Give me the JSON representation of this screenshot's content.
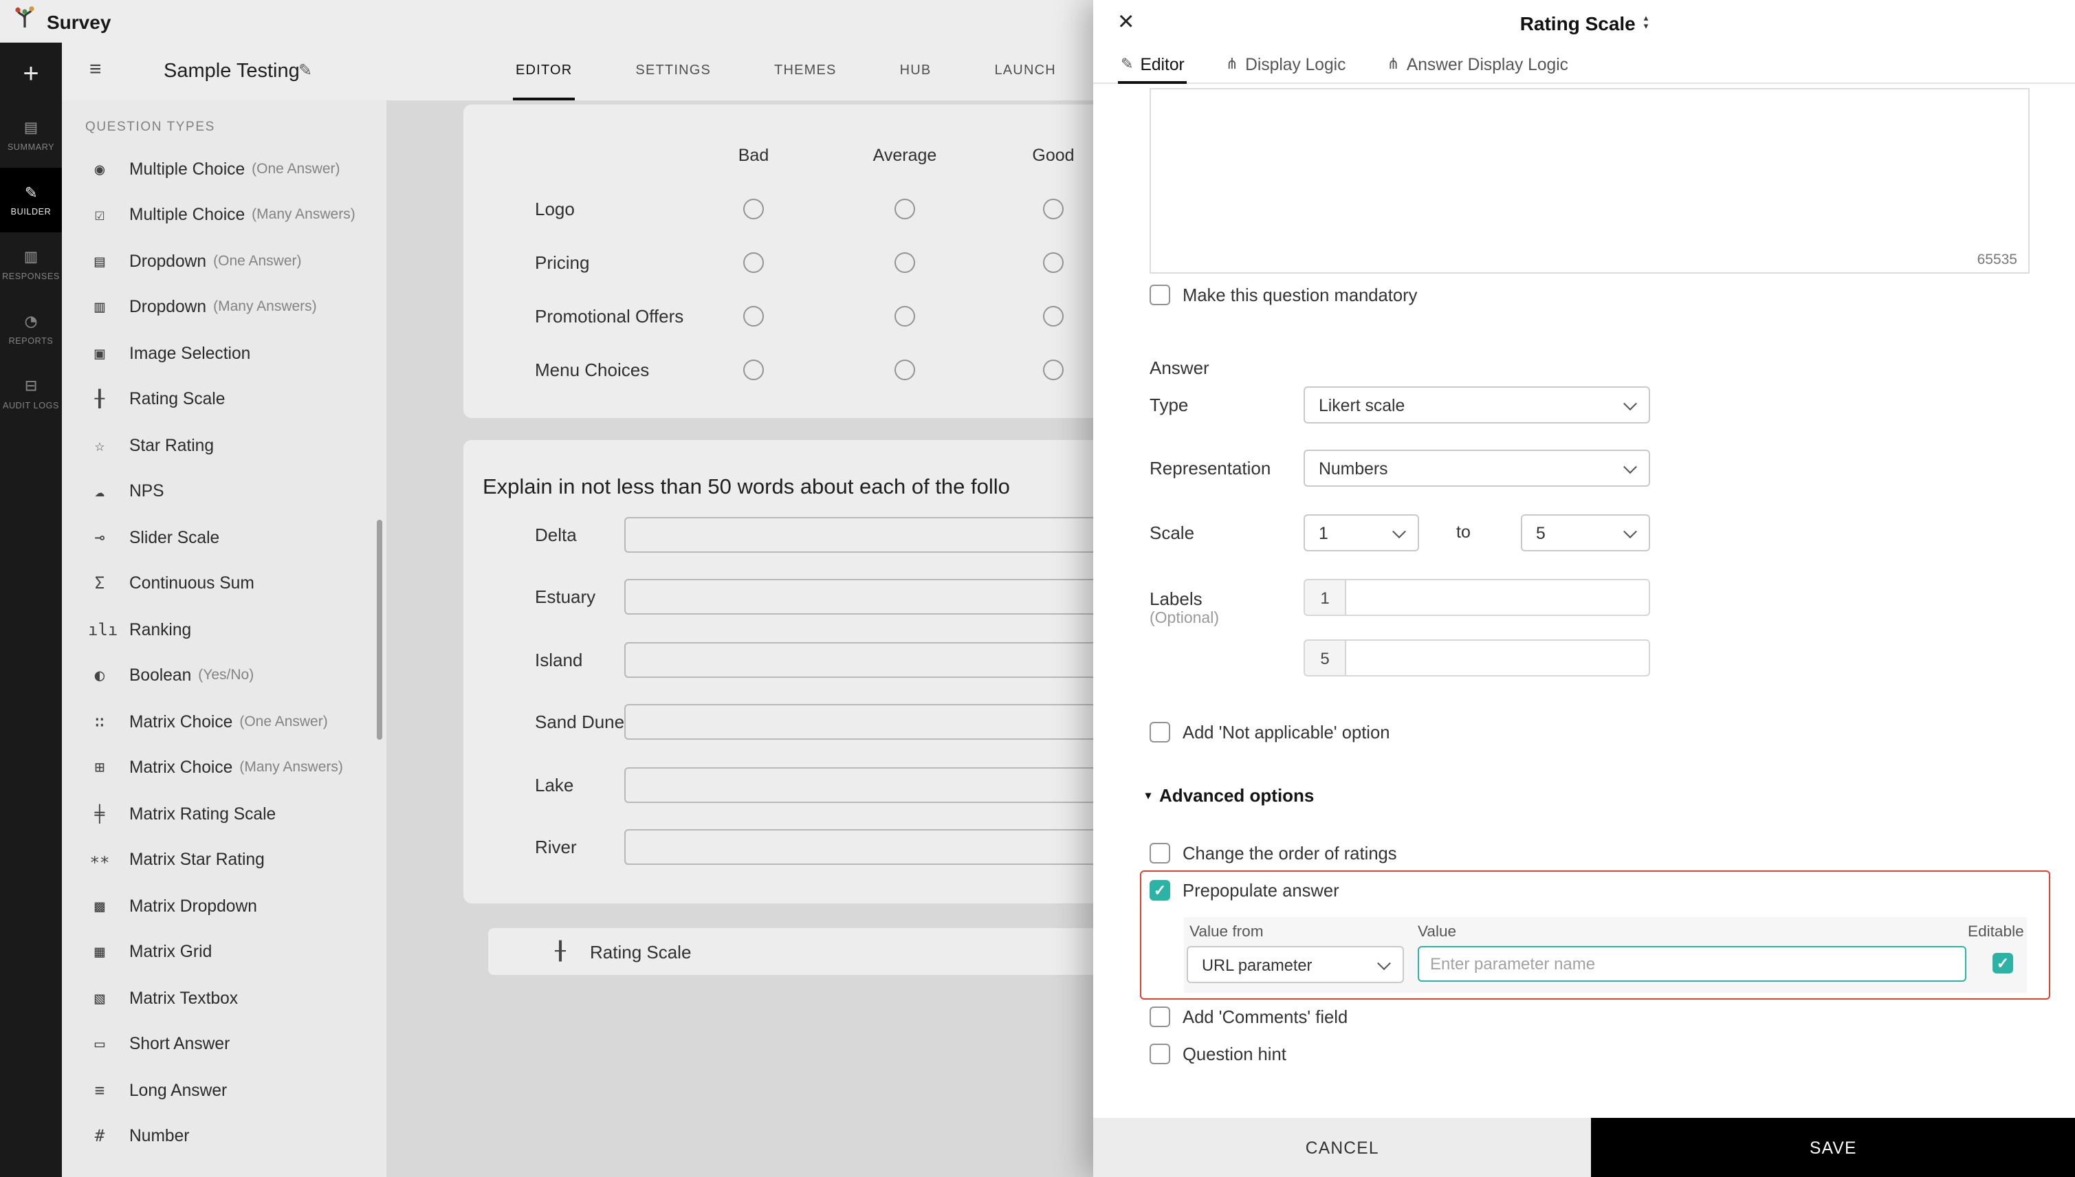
{
  "app": {
    "logo_text": "Survey"
  },
  "rail": {
    "add_label": "+",
    "items": [
      {
        "icon": "summary-icon",
        "label": "SUMMARY",
        "active": false
      },
      {
        "icon": "builder-icon",
        "label": "BUILDER",
        "active": true
      },
      {
        "icon": "responses-icon",
        "label": "RESPONSES",
        "active": false
      },
      {
        "icon": "reports-icon",
        "label": "REPORTS",
        "active": false
      },
      {
        "icon": "audit-logs-icon",
        "label": "AUDIT LOGS",
        "active": false
      }
    ]
  },
  "survey": {
    "name": "Sample Testing"
  },
  "top_tabs": [
    {
      "label": "EDITOR",
      "active": true
    },
    {
      "label": "SETTINGS",
      "active": false
    },
    {
      "label": "THEMES",
      "active": false
    },
    {
      "label": "HUB",
      "active": false
    },
    {
      "label": "LAUNCH",
      "active": false
    }
  ],
  "sidebar": {
    "header": "QUESTION TYPES",
    "items": [
      {
        "icon": "multiple-choice-one-icon",
        "label": "Multiple Choice",
        "sub": "(One Answer)"
      },
      {
        "icon": "multiple-choice-many-icon",
        "label": "Multiple Choice",
        "sub": "(Many Answers)"
      },
      {
        "icon": "dropdown-one-icon",
        "label": "Dropdown",
        "sub": "(One Answer)"
      },
      {
        "icon": "dropdown-many-icon",
        "label": "Dropdown",
        "sub": "(Many Answers)"
      },
      {
        "icon": "image-selection-icon",
        "label": "Image Selection",
        "sub": ""
      },
      {
        "icon": "rating-scale-icon",
        "label": "Rating Scale",
        "sub": ""
      },
      {
        "icon": "star-rating-icon",
        "label": "Star Rating",
        "sub": ""
      },
      {
        "icon": "nps-icon",
        "label": "NPS",
        "sub": ""
      },
      {
        "icon": "slider-scale-icon",
        "label": "Slider Scale",
        "sub": ""
      },
      {
        "icon": "continuous-sum-icon",
        "label": "Continuous Sum",
        "sub": ""
      },
      {
        "icon": "ranking-icon",
        "label": "Ranking",
        "sub": ""
      },
      {
        "icon": "boolean-icon",
        "label": "Boolean",
        "sub": "(Yes/No)"
      },
      {
        "icon": "matrix-choice-one-icon",
        "label": "Matrix Choice",
        "sub": "(One Answer)"
      },
      {
        "icon": "matrix-choice-many-icon",
        "label": "Matrix Choice",
        "sub": "(Many Answers)"
      },
      {
        "icon": "matrix-rating-scale-icon",
        "label": "Matrix Rating Scale",
        "sub": ""
      },
      {
        "icon": "matrix-star-rating-icon",
        "label": "Matrix Star Rating",
        "sub": ""
      },
      {
        "icon": "matrix-dropdown-icon",
        "label": "Matrix Dropdown",
        "sub": ""
      },
      {
        "icon": "matrix-grid-icon",
        "label": "Matrix Grid",
        "sub": ""
      },
      {
        "icon": "matrix-textbox-icon",
        "label": "Matrix Textbox",
        "sub": ""
      },
      {
        "icon": "short-answer-icon",
        "label": "Short Answer",
        "sub": ""
      },
      {
        "icon": "long-answer-icon",
        "label": "Long Answer",
        "sub": ""
      },
      {
        "icon": "number-icon",
        "label": "Number",
        "sub": ""
      }
    ]
  },
  "canvas": {
    "matrix": {
      "columns": [
        "Bad",
        "Average",
        "Good"
      ],
      "rows": [
        "Logo",
        "Pricing",
        "Promotional Offers",
        "Menu Choices"
      ]
    },
    "essay": {
      "title": "Explain in not less than 50 words about each of the follo",
      "rows": [
        "Delta",
        "Estuary",
        "Island",
        "Sand Dune",
        "Lake",
        "River"
      ]
    },
    "rating_item_label": "Rating Scale"
  },
  "modal": {
    "title": "Rating Scale",
    "tabs": [
      {
        "icon": "pencil-icon",
        "label": "Editor",
        "active": true
      },
      {
        "icon": "fork-icon",
        "label": "Display Logic",
        "active": false
      },
      {
        "icon": "fork-icon",
        "label": "Answer Display Logic",
        "active": false
      }
    ],
    "char_count": "65535",
    "mandatory": {
      "label": "Make this question mandatory",
      "checked": false
    },
    "answer": {
      "section_label": "Answer",
      "type_label": "Type",
      "type_value": "Likert scale",
      "representation_label": "Representation",
      "representation_value": "Numbers",
      "scale_label": "Scale",
      "scale_from_value": "1",
      "scale_to_word": "to",
      "scale_to_value": "5",
      "labels_label": "Labels",
      "labels_optional": "(Optional)",
      "label_rows": [
        {
          "prefix": "1",
          "value": ""
        },
        {
          "prefix": "5",
          "value": ""
        }
      ],
      "not_applicable": {
        "label": "Add 'Not applicable' option",
        "checked": false
      }
    },
    "advanced": {
      "header": "Advanced options",
      "change_order": {
        "label": "Change the order of ratings",
        "checked": false
      },
      "prepopulate": {
        "label": "Prepopulate answer",
        "checked": true
      },
      "value_from_label": "Value from",
      "value_from_value": "URL parameter",
      "value_label": "Value",
      "value_placeholder": "Enter parameter name",
      "editable": {
        "label": "Editable",
        "checked": true
      },
      "comments": {
        "label": "Add 'Comments' field",
        "checked": false
      },
      "hint": {
        "label": "Question hint",
        "checked": false
      }
    },
    "footer": {
      "cancel_label": "CANCEL",
      "save_label": "SAVE"
    }
  },
  "colors": {
    "accent": "#2bb3a6",
    "highlight": "#e0412c"
  }
}
